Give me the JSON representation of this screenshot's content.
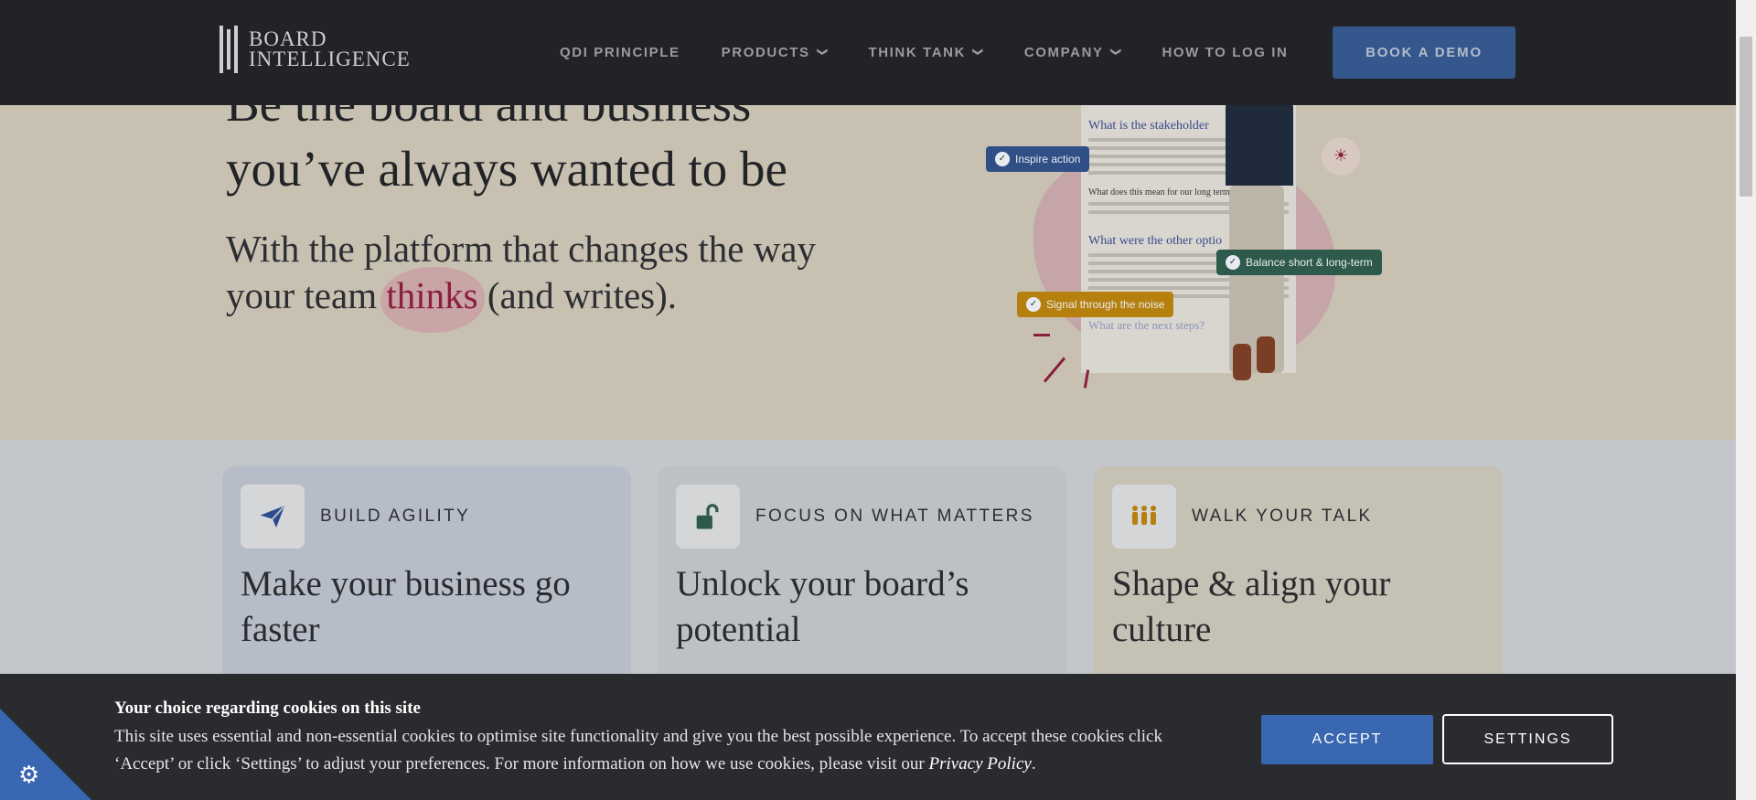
{
  "nav": {
    "logo_line1": "BOARD",
    "logo_line2": "INTELLIGENCE",
    "items": [
      {
        "label": "QDI PRINCIPLE",
        "has_dropdown": false
      },
      {
        "label": "PRODUCTS",
        "has_dropdown": true
      },
      {
        "label": "THINK TANK",
        "has_dropdown": true
      },
      {
        "label": "COMPANY",
        "has_dropdown": true
      },
      {
        "label": "HOW TO LOG IN",
        "has_dropdown": false
      }
    ],
    "cta": "BOOK A DEMO"
  },
  "hero": {
    "headline": "Be the board and business you’ve always wanted to be",
    "sub_before": "With the platform that changes the way your team ",
    "sub_highlight": "thinks",
    "sub_after": " (and writes).",
    "illustration": {
      "tags": [
        "Inspire action",
        "Balance short & long-term",
        "Signal through the noise"
      ],
      "doc_headings": [
        "What is the stakeholder",
        "What does this mean for our long term",
        "What were the other optio",
        "What are the next steps?"
      ]
    }
  },
  "cards": [
    {
      "label": "BUILD AGILITY",
      "heading": "Make your business go faster",
      "icon": "paper-plane-icon"
    },
    {
      "label": "FOCUS ON WHAT MATTERS",
      "heading": "Unlock your board’s potential",
      "icon": "unlocked-padlock-icon"
    },
    {
      "label": "WALK YOUR TALK",
      "heading": "Shape & align your culture",
      "icon": "people-group-icon"
    }
  ],
  "cookie": {
    "title": "Your choice regarding cookies on this site",
    "body": "This site uses essential and non-essential cookies to optimise site functionality and give you the best possible experience. To accept these cookies click ‘Accept’ or click ‘Settings’ to adjust your preferences. For more information on how we use cookies, please visit our ",
    "link": "Privacy Policy",
    "body_end": ".",
    "accept": "ACCEPT",
    "settings": "SETTINGS"
  },
  "colors": {
    "nav_bg": "#222326",
    "accent_blue": "#3a67b1",
    "highlight": "#8a1e3d",
    "tag_blue": "#2f4f86",
    "tag_green": "#2e5a4c",
    "tag_amber": "#b5800d"
  }
}
